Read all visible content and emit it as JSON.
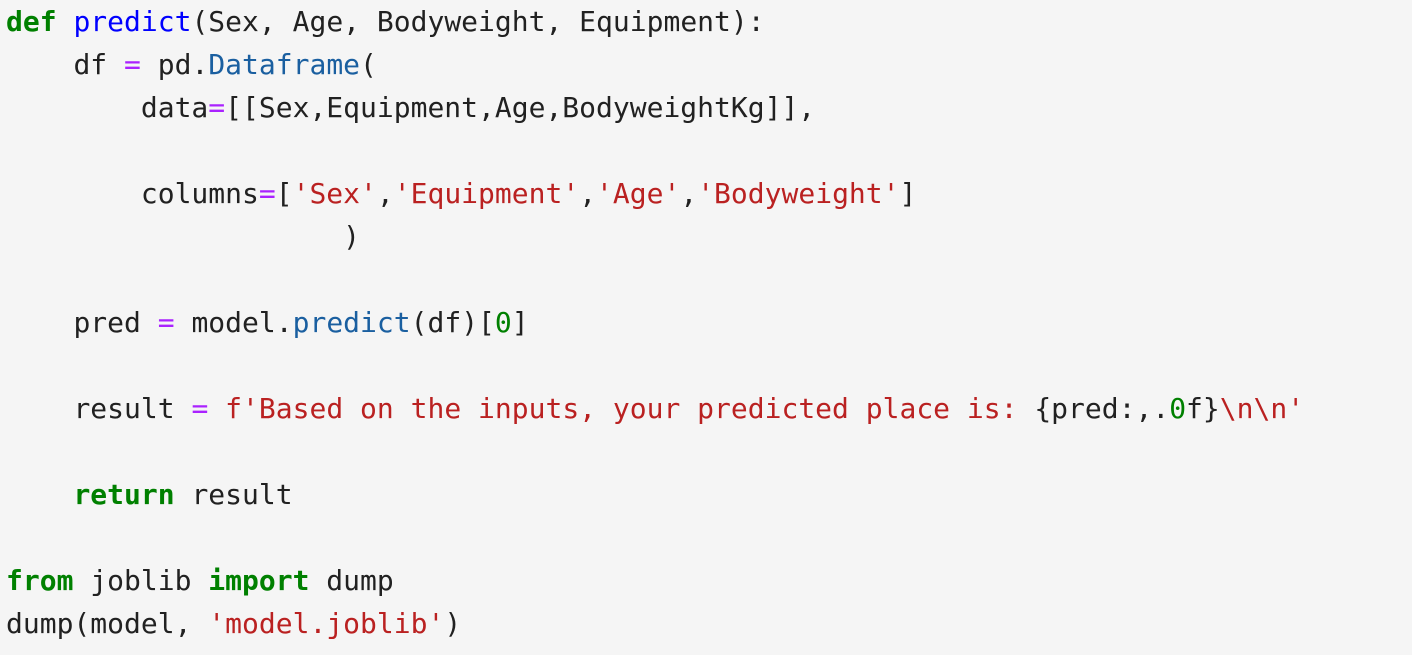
{
  "code": {
    "line1": {
      "kw": "def",
      "sp": " ",
      "fn": "predict",
      "rest": "(Sex, Age, Bodyweight, Equipment):"
    },
    "line2": {
      "indent": "    ",
      "a": "df",
      "sp1": " ",
      "op": "=",
      "sp2": " ",
      "b": "pd.",
      "attr": "Dataframe",
      "c": "("
    },
    "line3": {
      "indent": "        ",
      "a": "data",
      "op": "=",
      "b": "[[Sex,Equipment,Age,BodyweightKg]],"
    },
    "line4": {
      "text": ""
    },
    "line5": {
      "indent": "        ",
      "a": "columns",
      "op": "=",
      "b": "[",
      "s1": "'Sex'",
      "c1": ",",
      "s2": "'Equipment'",
      "c2": ",",
      "s3": "'Age'",
      "c3": ",",
      "s4": "'Bodyweight'",
      "d": "]"
    },
    "line6": {
      "indent": "                    ",
      "a": ")"
    },
    "line7": {
      "text": ""
    },
    "line8": {
      "indent": "    ",
      "a": "pred",
      "sp1": " ",
      "op": "=",
      "sp2": " ",
      "b": "model.",
      "attr": "predict",
      "c": "(df)[",
      "num": "0",
      "d": "]"
    },
    "line9": {
      "text": ""
    },
    "line10": {
      "indent": "    ",
      "a": "result",
      "sp1": " ",
      "op": "=",
      "sp2": " ",
      "str1": "f'Based on the inputs, your predicted place is: ",
      "interp1": "{pred:,.",
      "num": "0",
      "interp2": "f}",
      "esc": "\\n\\n",
      "str2": "'"
    },
    "line11": {
      "text": ""
    },
    "line12": {
      "indent": "    ",
      "kw": "return",
      "sp": " ",
      "a": "result"
    },
    "line13": {
      "text": ""
    },
    "line14": {
      "kw1": "from",
      "a": " joblib ",
      "kw2": "import",
      "b": " dump"
    },
    "line15": {
      "a": "dump(model, ",
      "str": "'model.joblib'",
      "b": ")"
    }
  }
}
